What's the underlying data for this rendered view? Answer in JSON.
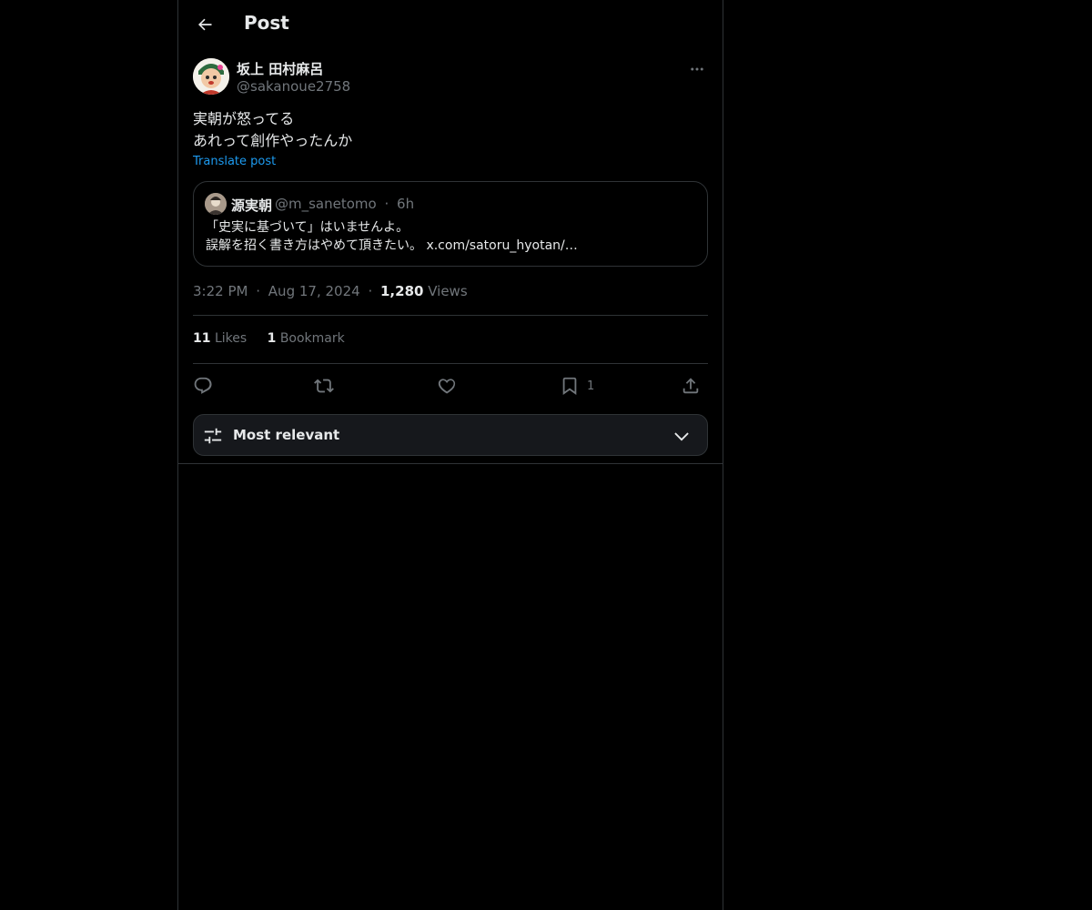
{
  "header": {
    "title": "Post",
    "back_icon": "arrow-left-icon"
  },
  "post": {
    "author_name": "坂上 田村麻呂",
    "author_handle": "@sakanoue2758",
    "text_lines": [
      "実朝が怒ってる",
      "あれって創作やったんか"
    ],
    "translate_label": "Translate post",
    "time": "3:22 PM",
    "date": "Aug 17, 2024",
    "views_count": "1,280",
    "views_label": "Views",
    "separator": "·"
  },
  "quote": {
    "name": "源実朝",
    "handle": "@m_sanetomo",
    "time": "6h",
    "text_lines": [
      "「史実に基づいて」はいませんよ。",
      "誤解を招く書き方はやめて頂きたい。 x.com/satoru_hyotan/…"
    ]
  },
  "stats": {
    "likes_count": "11",
    "likes_label": "Likes",
    "bookmarks_count": "1",
    "bookmarks_label": "Bookmark"
  },
  "actions": {
    "reply_icon": "reply-icon",
    "repost_icon": "repost-icon",
    "like_icon": "heart-icon",
    "bookmark_icon": "bookmark-icon",
    "bookmark_count": "1",
    "share_icon": "share-icon"
  },
  "sort": {
    "label": "Most relevant",
    "icon": "sliders-icon",
    "chevron": "chevron-down-icon"
  },
  "colors": {
    "background": "#000000",
    "text_primary": "#e7e9ea",
    "text_secondary": "#71767b",
    "accent": "#1d9bf0",
    "border": "#2f3336"
  }
}
